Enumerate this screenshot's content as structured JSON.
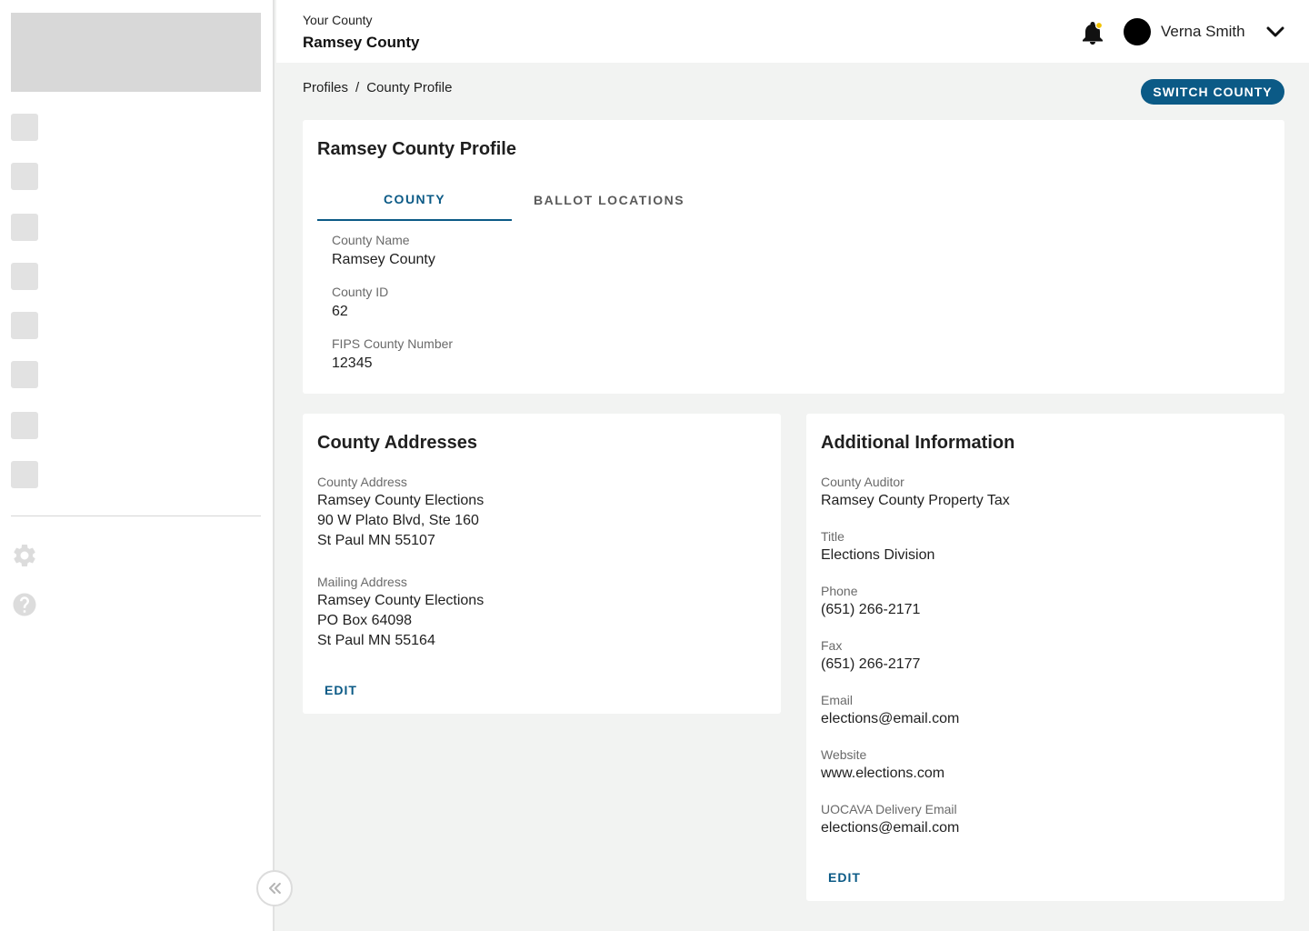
{
  "header": {
    "county_label": "Your County",
    "county_name": "Ramsey County",
    "user_name": "Verna Smith"
  },
  "breadcrumb": {
    "items": [
      "Profiles",
      "/",
      "County Profile"
    ]
  },
  "actions": {
    "switch_county": "SWITCH COUNTY"
  },
  "profile": {
    "title": "Ramsey County Profile",
    "tabs": [
      "COUNTY",
      "BALLOT LOCATIONS"
    ],
    "fields": [
      {
        "label": "County Name",
        "value": "Ramsey County"
      },
      {
        "label": "County ID",
        "value": "62"
      },
      {
        "label": "FIPS County Number",
        "value": "12345"
      }
    ]
  },
  "addresses": {
    "title": "County Addresses",
    "county_address": {
      "label": "County Address",
      "lines": [
        "Ramsey County Elections",
        "90 W Plato Blvd, Ste 160",
        "St Paul MN 55107"
      ]
    },
    "mailing_address": {
      "label": "Mailing Address",
      "lines": [
        "Ramsey County Elections",
        "PO Box 64098",
        "St Paul MN 55164"
      ]
    },
    "edit": "EDIT"
  },
  "additional": {
    "title": "Additional Information",
    "fields": [
      {
        "label": "County Auditor",
        "value": "Ramsey County Property Tax"
      },
      {
        "label": "Title",
        "value": "Elections Division"
      },
      {
        "label": "Phone",
        "value": "(651) 266-2171"
      },
      {
        "label": "Fax",
        "value": "(651) 266-2177"
      },
      {
        "label": "Email",
        "value": "elections@email.com"
      },
      {
        "label": "Website",
        "value": "www.elections.com"
      },
      {
        "label": "UOCAVA Delivery Email",
        "value": "elections@email.com"
      }
    ],
    "edit": "EDIT"
  },
  "colors": {
    "accent": "#0b5a86",
    "notification_dot": "#f2c200",
    "page_bg": "#f2f3f2"
  },
  "icons": {
    "settings": "gear-icon",
    "help": "help-circle-icon",
    "notifications": "bell-icon",
    "collapse": "double-chevron-left-icon",
    "user_menu": "chevron-down-icon"
  }
}
